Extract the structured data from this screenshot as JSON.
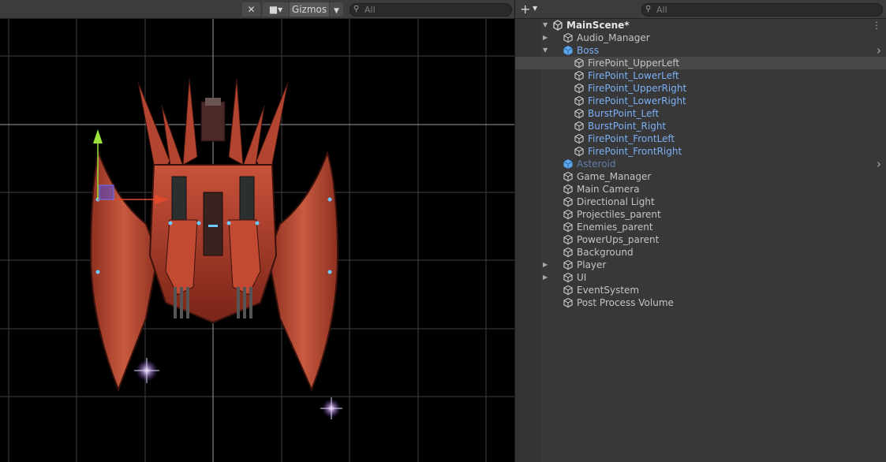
{
  "scene_toolbar": {
    "gizmos_label": "Gizmos",
    "search_placeholder": "All"
  },
  "hierarchy_toolbar": {
    "add_label": "+",
    "search_placeholder": "All"
  },
  "hierarchy": {
    "scene_name": "MainScene*",
    "items": [
      {
        "label": "Audio_Manager",
        "depth": 1,
        "arrow": "collapsed",
        "color": "normal"
      },
      {
        "label": "Boss",
        "depth": 1,
        "arrow": "expanded",
        "color": "blue",
        "blue_cube": true
      },
      {
        "label": "FirePoint_UpperLeft",
        "depth": 2,
        "arrow": "none",
        "color": "normal",
        "selected": true
      },
      {
        "label": "FirePoint_LowerLeft",
        "depth": 2,
        "arrow": "none",
        "color": "blue"
      },
      {
        "label": "FirePoint_UpperRight",
        "depth": 2,
        "arrow": "none",
        "color": "blue"
      },
      {
        "label": "FirePoint_LowerRight",
        "depth": 2,
        "arrow": "none",
        "color": "blue"
      },
      {
        "label": "BurstPoint_Left",
        "depth": 2,
        "arrow": "none",
        "color": "blue"
      },
      {
        "label": "BurstPoint_Right",
        "depth": 2,
        "arrow": "none",
        "color": "blue"
      },
      {
        "label": "FirePoint_FrontLeft",
        "depth": 2,
        "arrow": "none",
        "color": "blue"
      },
      {
        "label": "FirePoint_FrontRight",
        "depth": 2,
        "arrow": "none",
        "color": "blue"
      },
      {
        "label": "Asteroid",
        "depth": 1,
        "arrow": "none",
        "color": "dimblue",
        "blue_cube": true
      },
      {
        "label": "Game_Manager",
        "depth": 1,
        "arrow": "none",
        "color": "normal"
      },
      {
        "label": "Main Camera",
        "depth": 1,
        "arrow": "none",
        "color": "normal"
      },
      {
        "label": "Directional Light",
        "depth": 1,
        "arrow": "none",
        "color": "normal"
      },
      {
        "label": "Projectiles_parent",
        "depth": 1,
        "arrow": "none",
        "color": "normal"
      },
      {
        "label": "Enemies_parent",
        "depth": 1,
        "arrow": "none",
        "color": "normal"
      },
      {
        "label": "PowerUps_parent",
        "depth": 1,
        "arrow": "none",
        "color": "normal"
      },
      {
        "label": "Background",
        "depth": 1,
        "arrow": "none",
        "color": "normal"
      },
      {
        "label": "Player",
        "depth": 1,
        "arrow": "collapsed",
        "color": "normal"
      },
      {
        "label": "UI",
        "depth": 1,
        "arrow": "collapsed",
        "color": "normal"
      },
      {
        "label": "EventSystem",
        "depth": 1,
        "arrow": "none",
        "color": "normal"
      },
      {
        "label": "Post Process Volume",
        "depth": 1,
        "arrow": "none",
        "color": "normal"
      }
    ]
  },
  "icons": {
    "tools": "tools-icon",
    "camera": "camera-icon",
    "search": "search-icon",
    "unity_scene": "unity-scene-icon",
    "gameobject": "cube-icon"
  },
  "colors": {
    "scene_bg": "#000000",
    "panel_bg": "#383838",
    "selection": "#474747",
    "prefab_blue": "#7caff5",
    "boss_red": "#b8402e"
  }
}
